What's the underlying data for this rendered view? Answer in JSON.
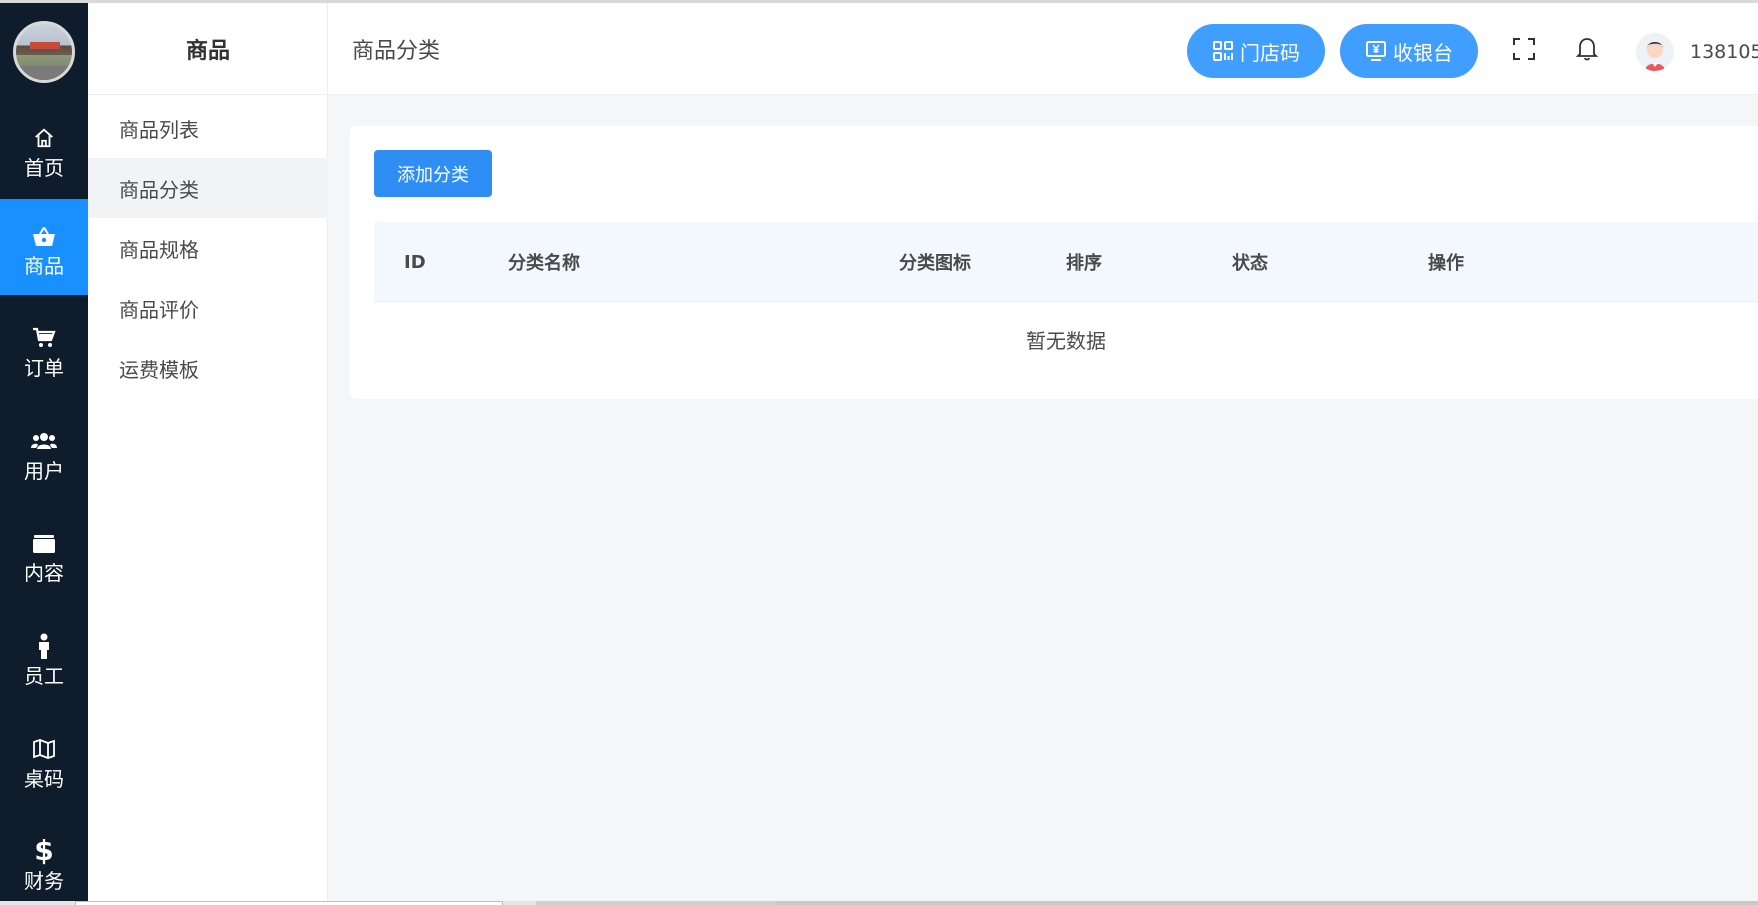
{
  "rail": {
    "items": [
      {
        "label": "首页",
        "icon": "home-icon"
      },
      {
        "label": "商品",
        "icon": "basket-icon",
        "active": true
      },
      {
        "label": "订单",
        "icon": "cart-icon"
      },
      {
        "label": "用户",
        "icon": "users-icon"
      },
      {
        "label": "内容",
        "icon": "folder-icon"
      },
      {
        "label": "员工",
        "icon": "person-icon"
      },
      {
        "label": "桌码",
        "icon": "map-icon"
      },
      {
        "label": "财务",
        "icon": "dollar-icon"
      }
    ]
  },
  "submenu": {
    "title": "商品",
    "items": [
      {
        "label": "商品列表"
      },
      {
        "label": "商品分类",
        "active": true
      },
      {
        "label": "商品规格"
      },
      {
        "label": "商品评价"
      },
      {
        "label": "运费模板"
      }
    ]
  },
  "header": {
    "page_title": "商品分类",
    "store_code_label": "门店码",
    "cashier_label": "收银台",
    "user_name": "138105",
    "icons": [
      "qrcode-icon",
      "cashier-icon",
      "fullscreen-icon",
      "bell-icon"
    ]
  },
  "main": {
    "add_button_label": "添加分类",
    "columns": [
      "ID",
      "分类名称",
      "分类图标",
      "排序",
      "状态",
      "操作"
    ],
    "empty_text": "暂无数据"
  },
  "colors": {
    "rail_bg": "#0f1c2c",
    "accent": "#1890ff",
    "button": "#409eff",
    "table_head_bg": "#f3f8ff"
  }
}
